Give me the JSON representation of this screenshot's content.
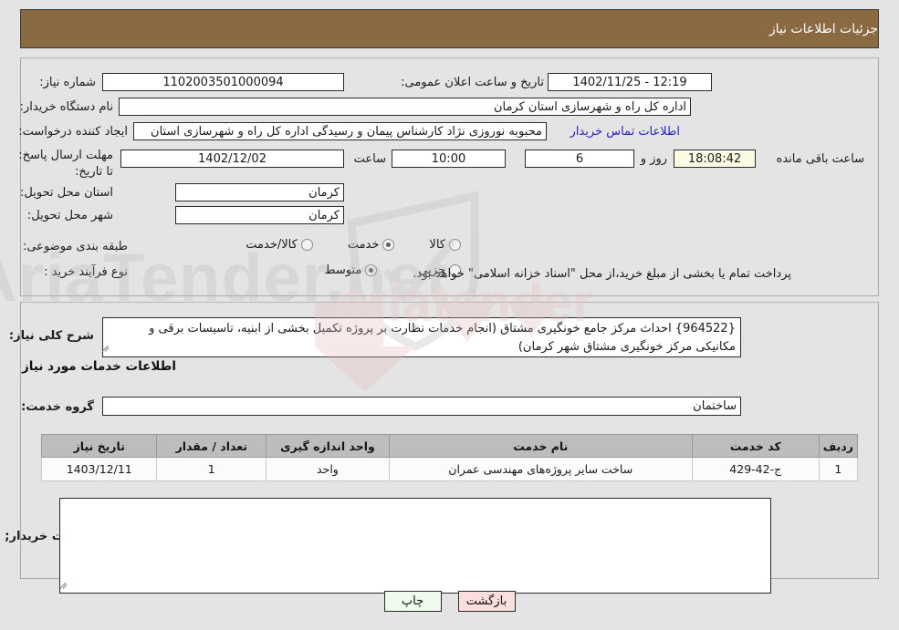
{
  "header": {
    "title": "جزئیات اطلاعات نیاز"
  },
  "colors": {
    "header_bg": "#8a6a40",
    "link": "#2323c8",
    "table_header_bg": "#bdbdbd",
    "btn_print_bg": "#effbef",
    "btn_back_bg": "#fbdede",
    "highlight_field_bg": "#fbfbe3"
  },
  "form": {
    "need_number_label": "شماره نیاز:",
    "need_number_value": "1102003501000094",
    "announce_datetime_label": "تاریخ و ساعت اعلان عمومی:",
    "announce_datetime_value": "12:19 - 1402/11/25",
    "buyer_org_label": "نام دستگاه خریدار:",
    "buyer_org_value": "اداره کل راه و شهرسازی استان کرمان",
    "requester_label": "ایجاد کننده درخواست:",
    "requester_value": "محبوبه نوروزی نژاد کارشناس پیمان و رسیدگی اداره کل راه و شهرسازی استان",
    "contact_link": "اطلاعات تماس خریدار",
    "deadline_label": "مهلت ارسال پاسخ: تا تاریخ:",
    "deadline_date": "1402/12/02",
    "deadline_hour_label": "ساعت",
    "deadline_hour_value": "10:00",
    "remaining_days_value": "6",
    "remaining_days_label": "روز و",
    "remaining_time_value": "18:08:42",
    "remaining_time_label": "ساعت باقی مانده",
    "delivery_province_label": "استان محل تحویل:",
    "delivery_province_value": "کرمان",
    "delivery_city_label": "شهر محل تحویل:",
    "delivery_city_value": "کرمان",
    "category_label": "طبقه بندی موضوعی:",
    "category_options": [
      {
        "label": "کالا",
        "selected": false
      },
      {
        "label": "خدمت",
        "selected": true
      },
      {
        "label": "کالا/خدمت",
        "selected": false
      }
    ],
    "process_label": "نوع فرآیند خرید :",
    "process_options": [
      {
        "label": "جزیی",
        "selected": false
      },
      {
        "label": "متوسط",
        "selected": true
      }
    ],
    "payment_note": "پرداخت تمام یا بخشی از مبلغ خرید،از محل \"اسناد خزانه اسلامی\" خواهد بود."
  },
  "need_description": {
    "label": "شرح کلی نیاز:",
    "value": "{964522} احداث مرکز جامع خونگیری مشتاق (انجام خدمات نظارت بر پروژه تکمیل بخشی از ابنیه، تاسیسات برقی و مکانیکی مرکز خونگیری مشتاق شهر کرمان)"
  },
  "services_section": {
    "title": "اطلاعات خدمات مورد نیاز",
    "service_group_label": "گروه خدمت:",
    "service_group_value": "ساختمان"
  },
  "table": {
    "columns": [
      "ردیف",
      "کد خدمت",
      "نام خدمت",
      "واحد اندازه گیری",
      "تعداد / مقدار",
      "تاریخ نیاز"
    ],
    "rows": [
      {
        "row": "1",
        "service_code": "ج-42-429",
        "service_name": "ساخت سایر پروژه‌های مهندسی عمران",
        "unit": "واحد",
        "quantity": "1",
        "need_date": "1403/12/11"
      }
    ]
  },
  "buyer_notes": {
    "label": "توضیحات خریدار;",
    "value": ""
  },
  "buttons": {
    "print": "چاپ",
    "back": "بازگشت"
  },
  "watermark": {
    "text": "AriaTender.net"
  }
}
